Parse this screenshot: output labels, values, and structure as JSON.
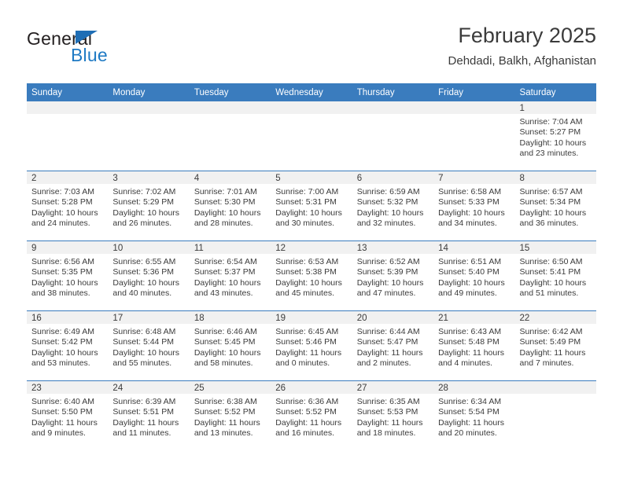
{
  "brand": {
    "name_part1": "General",
    "name_part2": "Blue",
    "colors": {
      "dark": "#231f20",
      "blue": "#1f7ac4",
      "header_blue": "#3a7cbe",
      "strip_gray": "#f1f1f1"
    }
  },
  "header": {
    "month_title": "February 2025",
    "location": "Dehdadi, Balkh, Afghanistan"
  },
  "weekday_headers": [
    "Sunday",
    "Monday",
    "Tuesday",
    "Wednesday",
    "Thursday",
    "Friday",
    "Saturday"
  ],
  "weeks": [
    [
      {
        "day": "",
        "lines": []
      },
      {
        "day": "",
        "lines": []
      },
      {
        "day": "",
        "lines": []
      },
      {
        "day": "",
        "lines": []
      },
      {
        "day": "",
        "lines": []
      },
      {
        "day": "",
        "lines": []
      },
      {
        "day": "1",
        "lines": [
          "Sunrise: 7:04 AM",
          "Sunset: 5:27 PM",
          "Daylight: 10 hours",
          "and 23 minutes."
        ]
      }
    ],
    [
      {
        "day": "2",
        "lines": [
          "Sunrise: 7:03 AM",
          "Sunset: 5:28 PM",
          "Daylight: 10 hours",
          "and 24 minutes."
        ]
      },
      {
        "day": "3",
        "lines": [
          "Sunrise: 7:02 AM",
          "Sunset: 5:29 PM",
          "Daylight: 10 hours",
          "and 26 minutes."
        ]
      },
      {
        "day": "4",
        "lines": [
          "Sunrise: 7:01 AM",
          "Sunset: 5:30 PM",
          "Daylight: 10 hours",
          "and 28 minutes."
        ]
      },
      {
        "day": "5",
        "lines": [
          "Sunrise: 7:00 AM",
          "Sunset: 5:31 PM",
          "Daylight: 10 hours",
          "and 30 minutes."
        ]
      },
      {
        "day": "6",
        "lines": [
          "Sunrise: 6:59 AM",
          "Sunset: 5:32 PM",
          "Daylight: 10 hours",
          "and 32 minutes."
        ]
      },
      {
        "day": "7",
        "lines": [
          "Sunrise: 6:58 AM",
          "Sunset: 5:33 PM",
          "Daylight: 10 hours",
          "and 34 minutes."
        ]
      },
      {
        "day": "8",
        "lines": [
          "Sunrise: 6:57 AM",
          "Sunset: 5:34 PM",
          "Daylight: 10 hours",
          "and 36 minutes."
        ]
      }
    ],
    [
      {
        "day": "9",
        "lines": [
          "Sunrise: 6:56 AM",
          "Sunset: 5:35 PM",
          "Daylight: 10 hours",
          "and 38 minutes."
        ]
      },
      {
        "day": "10",
        "lines": [
          "Sunrise: 6:55 AM",
          "Sunset: 5:36 PM",
          "Daylight: 10 hours",
          "and 40 minutes."
        ]
      },
      {
        "day": "11",
        "lines": [
          "Sunrise: 6:54 AM",
          "Sunset: 5:37 PM",
          "Daylight: 10 hours",
          "and 43 minutes."
        ]
      },
      {
        "day": "12",
        "lines": [
          "Sunrise: 6:53 AM",
          "Sunset: 5:38 PM",
          "Daylight: 10 hours",
          "and 45 minutes."
        ]
      },
      {
        "day": "13",
        "lines": [
          "Sunrise: 6:52 AM",
          "Sunset: 5:39 PM",
          "Daylight: 10 hours",
          "and 47 minutes."
        ]
      },
      {
        "day": "14",
        "lines": [
          "Sunrise: 6:51 AM",
          "Sunset: 5:40 PM",
          "Daylight: 10 hours",
          "and 49 minutes."
        ]
      },
      {
        "day": "15",
        "lines": [
          "Sunrise: 6:50 AM",
          "Sunset: 5:41 PM",
          "Daylight: 10 hours",
          "and 51 minutes."
        ]
      }
    ],
    [
      {
        "day": "16",
        "lines": [
          "Sunrise: 6:49 AM",
          "Sunset: 5:42 PM",
          "Daylight: 10 hours",
          "and 53 minutes."
        ]
      },
      {
        "day": "17",
        "lines": [
          "Sunrise: 6:48 AM",
          "Sunset: 5:44 PM",
          "Daylight: 10 hours",
          "and 55 minutes."
        ]
      },
      {
        "day": "18",
        "lines": [
          "Sunrise: 6:46 AM",
          "Sunset: 5:45 PM",
          "Daylight: 10 hours",
          "and 58 minutes."
        ]
      },
      {
        "day": "19",
        "lines": [
          "Sunrise: 6:45 AM",
          "Sunset: 5:46 PM",
          "Daylight: 11 hours",
          "and 0 minutes."
        ]
      },
      {
        "day": "20",
        "lines": [
          "Sunrise: 6:44 AM",
          "Sunset: 5:47 PM",
          "Daylight: 11 hours",
          "and 2 minutes."
        ]
      },
      {
        "day": "21",
        "lines": [
          "Sunrise: 6:43 AM",
          "Sunset: 5:48 PM",
          "Daylight: 11 hours",
          "and 4 minutes."
        ]
      },
      {
        "day": "22",
        "lines": [
          "Sunrise: 6:42 AM",
          "Sunset: 5:49 PM",
          "Daylight: 11 hours",
          "and 7 minutes."
        ]
      }
    ],
    [
      {
        "day": "23",
        "lines": [
          "Sunrise: 6:40 AM",
          "Sunset: 5:50 PM",
          "Daylight: 11 hours",
          "and 9 minutes."
        ]
      },
      {
        "day": "24",
        "lines": [
          "Sunrise: 6:39 AM",
          "Sunset: 5:51 PM",
          "Daylight: 11 hours",
          "and 11 minutes."
        ]
      },
      {
        "day": "25",
        "lines": [
          "Sunrise: 6:38 AM",
          "Sunset: 5:52 PM",
          "Daylight: 11 hours",
          "and 13 minutes."
        ]
      },
      {
        "day": "26",
        "lines": [
          "Sunrise: 6:36 AM",
          "Sunset: 5:52 PM",
          "Daylight: 11 hours",
          "and 16 minutes."
        ]
      },
      {
        "day": "27",
        "lines": [
          "Sunrise: 6:35 AM",
          "Sunset: 5:53 PM",
          "Daylight: 11 hours",
          "and 18 minutes."
        ]
      },
      {
        "day": "28",
        "lines": [
          "Sunrise: 6:34 AM",
          "Sunset: 5:54 PM",
          "Daylight: 11 hours",
          "and 20 minutes."
        ]
      },
      {
        "day": "",
        "lines": []
      }
    ]
  ]
}
